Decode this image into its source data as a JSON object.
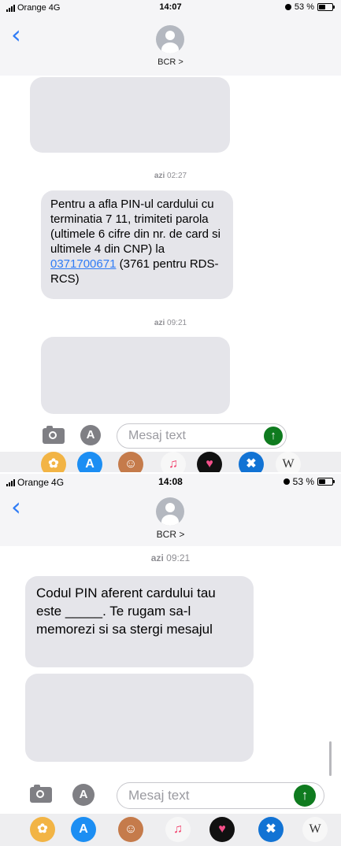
{
  "screen1": {
    "status": {
      "carrier": "Orange",
      "network": "4G",
      "time": "14:07",
      "battery": "53 %"
    },
    "contact": "BCR >",
    "messages": [
      {
        "kind": "hidden"
      },
      {
        "timestamp_day": "azi",
        "timestamp_time": "02:27"
      },
      {
        "text_before_link": "Pentru a afla PIN-ul cardului cu terminatia 7 11, trimiteti parola (ultimele 6 cifre din nr. de card si ultimele 4 din CNP) la ",
        "link": "0371700671",
        "text_after_link": " (3761 pentru RDS-RCS)"
      },
      {
        "timestamp_day": "azi",
        "timestamp_time": "09:21"
      },
      {
        "kind": "hidden"
      }
    ],
    "composer": {
      "placeholder": "Mesaj text",
      "send_icon": "arrow-up-icon"
    }
  },
  "screen2": {
    "status": {
      "carrier": "Orange",
      "network": "4G",
      "time": "14:08",
      "battery": "53 %"
    },
    "contact": "BCR >",
    "timestamp_day": "azi",
    "timestamp_time": "09:21",
    "message_text": "Codul PIN aferent cardului tau este _____. Te rugam sa-l memorezi si sa stergi mesajul",
    "composer": {
      "placeholder": "Mesaj text",
      "send_icon": "arrow-up-icon"
    }
  },
  "app_strip": {
    "apps": [
      "photos-app-icon",
      "app-store-icon",
      "memoji-icon",
      "music-icon",
      "heart-sticker-icon",
      "fitness-icon",
      "wikipedia-icon"
    ],
    "wikipedia_letter": "W"
  },
  "colors": {
    "accent": "#2f7cf6",
    "bubble": "#e5e5ea",
    "send": "#0f7b1f"
  }
}
